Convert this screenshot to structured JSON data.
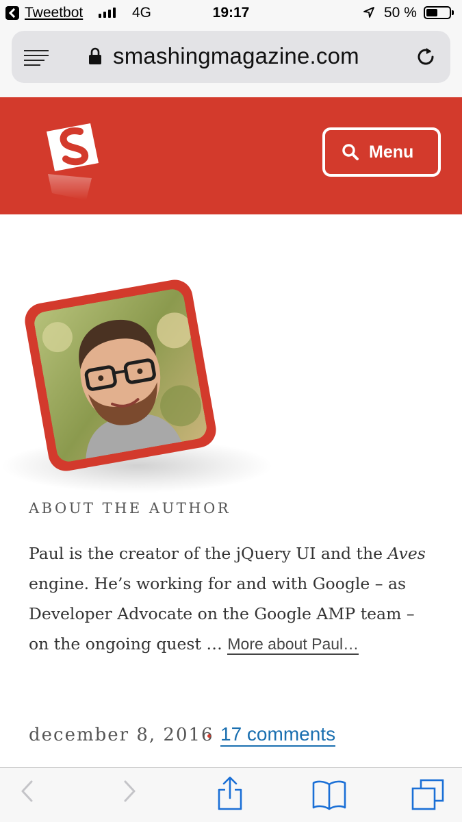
{
  "status_bar": {
    "back_app": "Tweetbot",
    "network": "4G",
    "time": "19:17",
    "battery": "50 %",
    "battery_level": 0.5
  },
  "browser": {
    "url": "smashingmagazine.com"
  },
  "header": {
    "menu_label": "Menu",
    "brand_color": "#d33a2c"
  },
  "author": {
    "section_label": "ABOUT THE AUTHOR",
    "bio_before_italic": "Paul is the creator of the jQuery UI and the ",
    "bio_italic": "Aves",
    "bio_after_italic": " engine. He’s working for and with Google – as Developer Advocate on the Google AMP team – on the ongoing quest … ",
    "more_link": "More about Paul…"
  },
  "meta": {
    "date": "december 8, 2016",
    "comments": "17 comments",
    "link_color": "#1a6fb0"
  },
  "toolbar": {
    "icons": [
      "back-icon",
      "forward-icon",
      "share-icon",
      "bookmarks-icon",
      "tabs-icon"
    ]
  }
}
